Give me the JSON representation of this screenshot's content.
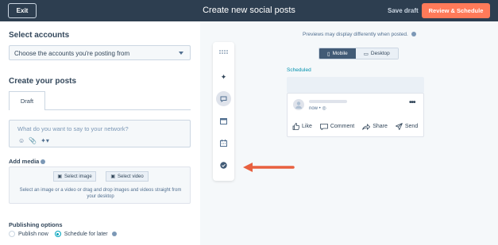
{
  "header": {
    "exit_label": "Exit",
    "title": "Create new social posts",
    "save_draft_label": "Save draft",
    "review_label": "Review & Schedule"
  },
  "left": {
    "select_accounts_heading": "Select accounts",
    "accounts_select_value": "Choose the accounts you're posting from",
    "create_posts_heading": "Create your posts",
    "tab_draft": "Draft",
    "composer_placeholder": "What do you want to say to your network?",
    "add_media_label": "Add media",
    "select_image_label": "Select image",
    "select_video_label": "Select video",
    "media_help": "Select an image or a video or drag and drop images and videos straight from your desktop",
    "publishing_options_label": "Publishing options",
    "publish_now_label": "Publish now",
    "schedule_later_label": "Schedule for later",
    "selected_option": "Schedule for later"
  },
  "toolbar": {
    "icons": [
      "dots-grid-icon",
      "sparkle-icon",
      "comment-icon",
      "calendar-window-icon",
      "calendar-icon",
      "check-circle-icon"
    ],
    "active_icon": "comment-icon"
  },
  "preview": {
    "note": "Previews may display differently when posted.",
    "mobile_label": "Mobile",
    "desktop_label": "Desktop",
    "selected_view": "Mobile",
    "scheduled_label": "Scheduled",
    "time_label": "now •",
    "like_label": "Like",
    "comment_label": "Comment",
    "share_label": "Share",
    "send_label": "Send"
  },
  "colors": {
    "header_bg": "#2d3e50",
    "accent_orange": "#ff7a59",
    "arrow_color": "#e8603f",
    "teal": "#00a4bd"
  }
}
